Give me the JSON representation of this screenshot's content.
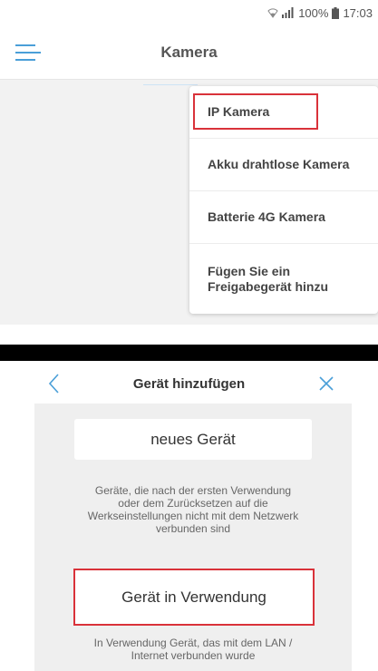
{
  "status_bar": {
    "battery": "100%",
    "time": "17:03"
  },
  "header": {
    "title": "Kamera"
  },
  "dropdown": {
    "items": [
      {
        "label": "IP Kamera",
        "highlighted": true
      },
      {
        "label": "Akku drahtlose Kamera"
      },
      {
        "label": "Batterie 4G Kamera"
      },
      {
        "label": "Fügen Sie ein Freigabegerät hinzu"
      }
    ]
  },
  "add_device": {
    "title": "Gerät hinzufügen",
    "new_device": {
      "label": "neues Gerät",
      "description_lines": [
        "Geräte, die nach der ersten Verwendung",
        "oder dem Zurücksetzen auf die",
        "Werkseinstellungen nicht mit dem Netzwerk",
        "verbunden sind"
      ]
    },
    "device_in_use": {
      "label": "Gerät in Verwendung",
      "highlighted": true,
      "description_lines": [
        "In Verwendung Gerät, das mit dem LAN /",
        "Internet verbunden wurde"
      ]
    }
  },
  "colors": {
    "accent": "#4a9fd8",
    "highlight": "#d9323a"
  },
  "icons": {
    "menu": "hamburger-menu-icon",
    "back": "chevron-left-icon",
    "close": "close-icon",
    "wifi": "wifi-icon",
    "signal": "signal-icon",
    "battery": "battery-icon"
  }
}
